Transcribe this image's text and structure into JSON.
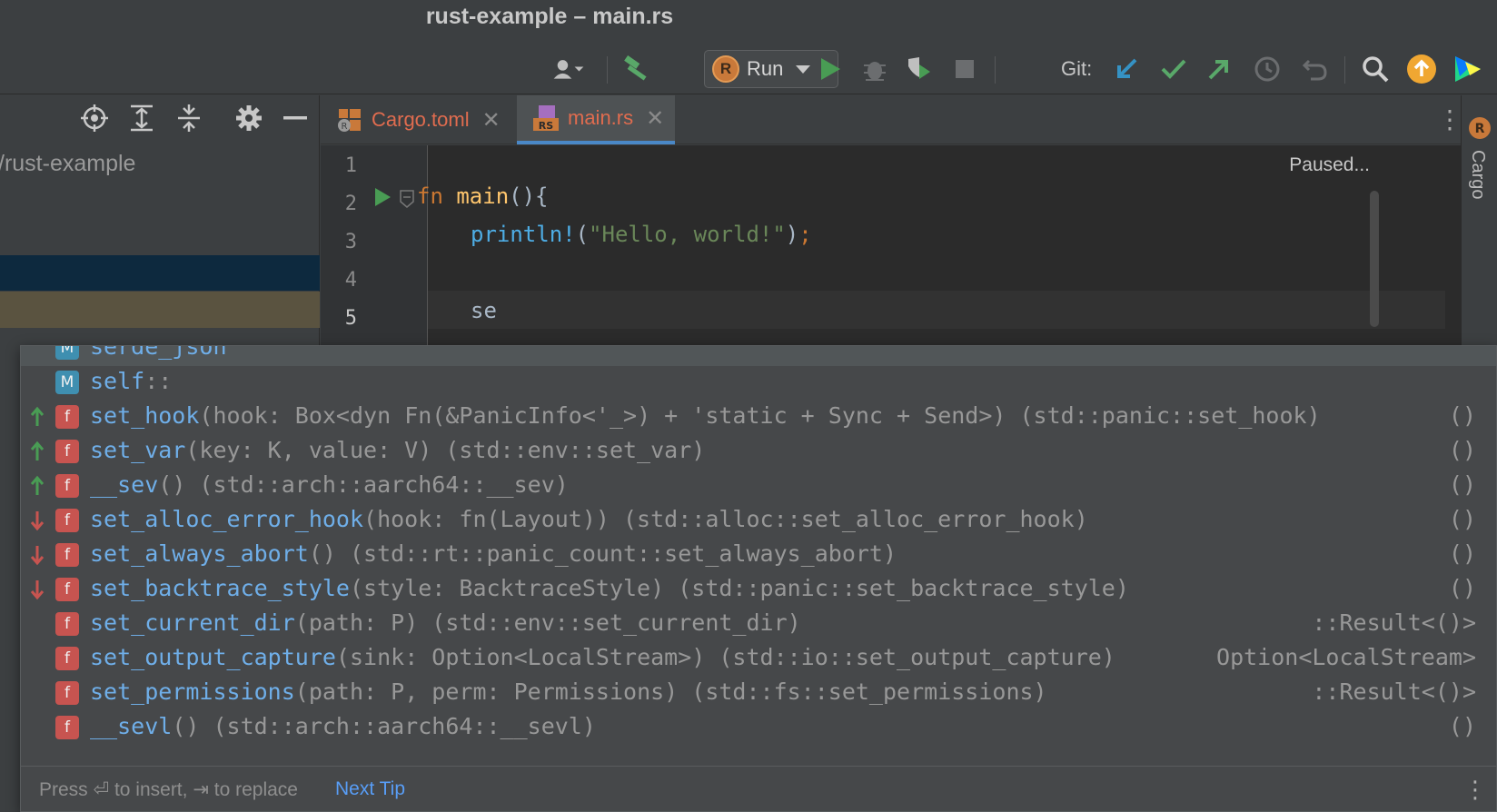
{
  "window": {
    "title": "rust-example – main.rs"
  },
  "toolbar": {
    "run_config_label": "Run",
    "git_label": "Git:"
  },
  "project": {
    "path_label": "/rust-example"
  },
  "tabs": [
    {
      "label": "Cargo.toml",
      "active": false
    },
    {
      "label": "main.rs",
      "active": true
    }
  ],
  "editor": {
    "status": "Paused...",
    "line_numbers": [
      "1",
      "2",
      "3",
      "4",
      "5"
    ],
    "lines": {
      "l2_kw": "fn",
      "l2_name": "main",
      "l2_rest": "(){",
      "l3_macro": "println!",
      "l3_open": "(",
      "l3_str": "\"Hello, world!\"",
      "l3_close": ")",
      "l3_semi": ";",
      "l5_typed": "se"
    }
  },
  "completion": {
    "items": [
      {
        "kind": "M",
        "kind_type": "module",
        "name": "serde_json",
        "tail": "",
        "ret": "",
        "arrow": ""
      },
      {
        "kind": "M",
        "kind_type": "module",
        "name": "self",
        "tail": "::",
        "ret": "",
        "arrow": ""
      },
      {
        "kind": "f",
        "kind_type": "function",
        "name": "set_hook",
        "tail": "(hook: Box<dyn Fn(&PanicInfo<'_>) + 'static + Sync + Send>) (std::panic::set_hook)",
        "ret": "()",
        "arrow": "up"
      },
      {
        "kind": "f",
        "kind_type": "function",
        "name": "set_var",
        "tail": "(key: K, value: V) (std::env::set_var)",
        "ret": "()",
        "arrow": "up"
      },
      {
        "kind": "f",
        "kind_type": "function",
        "name": "__sev",
        "tail": "() (std::arch::aarch64::__sev)",
        "ret": "()",
        "arrow": "up"
      },
      {
        "kind": "f",
        "kind_type": "function",
        "name": "set_alloc_error_hook",
        "tail": "(hook: fn(Layout)) (std::alloc::set_alloc_error_hook)",
        "ret": "()",
        "arrow": "down"
      },
      {
        "kind": "f",
        "kind_type": "function",
        "name": "set_always_abort",
        "tail": "() (std::rt::panic_count::set_always_abort)",
        "ret": "()",
        "arrow": "down"
      },
      {
        "kind": "f",
        "kind_type": "function",
        "name": "set_backtrace_style",
        "tail": "(style: BacktraceStyle) (std::panic::set_backtrace_style)",
        "ret": "()",
        "arrow": "down"
      },
      {
        "kind": "f",
        "kind_type": "function",
        "name": "set_current_dir",
        "tail": "(path: P) (std::env::set_current_dir)",
        "ret": "::Result<()>",
        "arrow": ""
      },
      {
        "kind": "f",
        "kind_type": "function",
        "name": "set_output_capture",
        "tail": "(sink: Option<LocalStream>) (std::io::set_output_capture)",
        "ret": "Option<LocalStream>",
        "arrow": ""
      },
      {
        "kind": "f",
        "kind_type": "function",
        "name": "set_permissions",
        "tail": "(path: P, perm: Permissions) (std::fs::set_permissions)",
        "ret": "::Result<()>",
        "arrow": ""
      },
      {
        "kind": "f",
        "kind_type": "function",
        "name": "__sevl",
        "tail": "() (std::arch::aarch64::__sevl)",
        "ret": "()",
        "arrow": ""
      }
    ],
    "footer_hint": "Press ⏎ to insert, ⇥ to replace",
    "next_tip": "Next Tip"
  },
  "side_tools": {
    "cargo_label": "Cargo"
  },
  "colors": {
    "accent_blue": "#4a88c7",
    "run_green": "#499c54",
    "git_update_blue": "#3592c4",
    "git_push_green": "#59a869",
    "error_red": "#c75450",
    "update_orange": "#f0a732"
  },
  "icons": [
    "user-icon",
    "build-hammer-icon",
    "rust-logo-icon",
    "run-icon",
    "debug-icon",
    "coverage-icon",
    "stop-icon",
    "git-update-icon",
    "git-commit-icon",
    "git-push-icon",
    "history-icon",
    "rollback-icon",
    "search-icon",
    "update-icon",
    "jetbrains-logo-icon",
    "locate-icon",
    "expand-all-icon",
    "collapse-all-icon",
    "gear-icon",
    "minimize-icon"
  ]
}
